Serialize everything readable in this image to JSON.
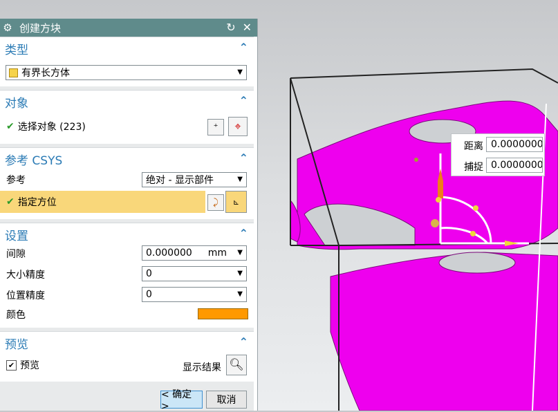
{
  "dialog": {
    "title": "创建方块",
    "icons": [
      "gear-icon",
      "reset-icon",
      "close-icon"
    ]
  },
  "type_section": {
    "title": "类型",
    "dropdown_value": "有界长方体"
  },
  "object_section": {
    "title": "对象",
    "select_label": "选择对象 (223)"
  },
  "csys_section": {
    "title": "参考 CSYS",
    "ref_label": "参考",
    "ref_value": "绝对 - 显示部件",
    "orient_label": "指定方位"
  },
  "settings_section": {
    "title": "设置",
    "gap_label": "间隙",
    "gap_value": "0.000000",
    "gap_unit": "mm",
    "size_precision_label": "大小精度",
    "size_precision_value": "0",
    "pos_precision_label": "位置精度",
    "pos_precision_value": "0",
    "color_label": "颜色",
    "color_value": "#ff9900"
  },
  "preview_section": {
    "title": "预览",
    "preview_label": "预览",
    "preview_checked": true,
    "show_result_label": "显示结果"
  },
  "buttons": {
    "ok": "< 确定 >",
    "cancel": "取消"
  },
  "snap_popup": {
    "distance_label": "距离",
    "distance_value": "0.0000000",
    "snap_label": "捕捉",
    "snap_value": "0.0000000"
  },
  "colors": {
    "titlebar": "#5f8b8b",
    "section_title": "#2b7bb5",
    "highlight": "#f9d77a",
    "part": "#ee00ee"
  }
}
